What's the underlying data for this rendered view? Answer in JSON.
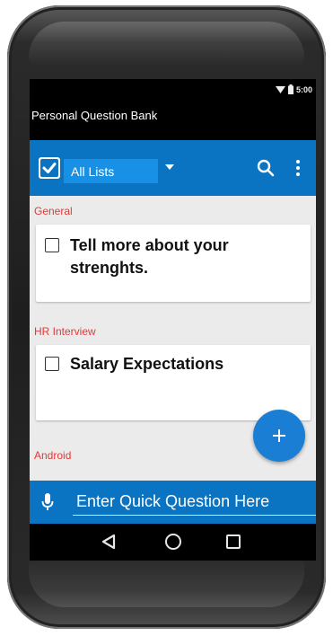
{
  "status_bar": {
    "time": "5:00",
    "wifi_icon": "wifi-icon",
    "battery_icon": "battery-icon"
  },
  "title_bar": {
    "title": "Personal Question Bank"
  },
  "toolbar": {
    "check_icon": "check-box-icon",
    "list_selector": "All Lists",
    "caret_icon": "dropdown-caret-icon",
    "search_icon": "search-icon",
    "more_icon": "more-vert-icon",
    "accent_color": "#0a73c2"
  },
  "sections": [
    {
      "label": "General",
      "questions": [
        "Tell more about your strenghts."
      ]
    },
    {
      "label": "HR Interview",
      "questions": [
        "Salary Expectations"
      ]
    },
    {
      "label": "Android",
      "questions": []
    }
  ],
  "fab": {
    "icon": "plus-icon"
  },
  "quick_input": {
    "placeholder": "Enter Quick Question Here",
    "value": "",
    "mic_icon": "mic-icon"
  },
  "nav_bar": {
    "back_icon": "back-icon",
    "home_icon": "home-icon",
    "recent_icon": "recent-apps-icon"
  },
  "colors": {
    "section_label": "#e53935",
    "background": "#ebebeb",
    "card": "#ffffff"
  }
}
